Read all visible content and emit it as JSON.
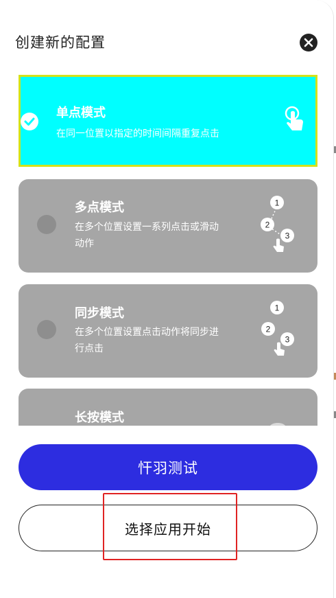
{
  "dialog": {
    "title": "创建新的配置",
    "close_icon": "close-icon"
  },
  "modes": [
    {
      "title": "单点模式",
      "description_lines": [
        "在同一位置以指定的时间间隔重复点击"
      ],
      "selected": true,
      "gesture_icon": "single-tap-icon"
    },
    {
      "title": "多点模式",
      "description_lines": [
        "在多个位置设置一系列点击或滑动",
        "动作"
      ],
      "selected": false,
      "gesture_icon": "multi-tap-icon",
      "gesture_numbers": [
        "1",
        "2",
        "3"
      ]
    },
    {
      "title": "同步模式",
      "description_lines": [
        "在多个位置设置点击动作将同步进",
        "行点击"
      ],
      "selected": false,
      "gesture_icon": "sync-tap-icon",
      "gesture_numbers": [
        "1",
        "2",
        "3"
      ]
    },
    {
      "title": "长按模式",
      "description_lines": [],
      "selected": false,
      "gesture_icon": "long-press-icon"
    }
  ],
  "buttons": {
    "start_label": "忓羽测试",
    "choose_app_label": "选择应用开始"
  },
  "colors": {
    "selected_card": "#00ffff",
    "selected_border": "#d4e21a",
    "card": "#a6a6a6",
    "primary_button": "#2d2de0",
    "highlight": "#e02222"
  }
}
